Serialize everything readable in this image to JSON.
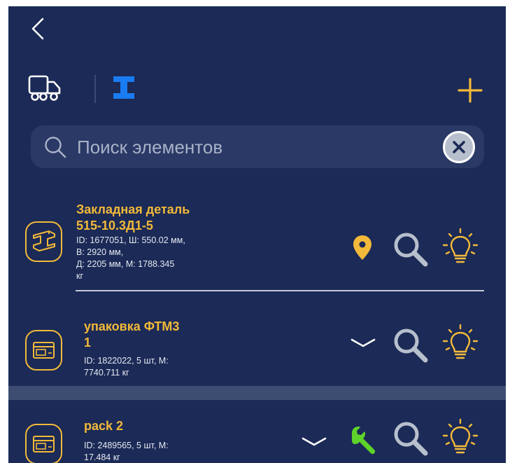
{
  "header": {
    "back_icon": "chevron-left-icon",
    "tabs": [
      {
        "icon": "truck-icon",
        "active": false
      },
      {
        "icon": "i-beam-icon",
        "active": true
      }
    ],
    "add_icon": "plus-icon"
  },
  "search": {
    "placeholder": "Поиск элементов",
    "value": ""
  },
  "items": [
    {
      "icon": "i-beam-icon",
      "title": "Закладная деталь\n515-10.3Д1-5",
      "meta": [
        "ID: 1677051, Ш: 550.02 мм,",
        "В: 2920 мм,",
        "Д: 2205 мм, М: 1788.345",
        "кг"
      ],
      "actions": [
        "location-pin-icon",
        "search-icon",
        "lightbulb-icon"
      ]
    },
    {
      "icon": "box-icon",
      "title": "упаковка ФТМ3\n1",
      "meta": [
        "ID: 1822022, 5 шт, М:",
        "7740.711 кг"
      ],
      "actions": [
        "chevron-down-icon",
        "search-icon",
        "lightbulb-icon"
      ]
    },
    {
      "icon": "box-icon",
      "title": "pack 2",
      "meta": [
        "ID: 2489565, 5 шт, М:",
        "17.484 кг"
      ],
      "actions": [
        "chevron-down-icon",
        "wrench-icon",
        "search-icon",
        "lightbulb-icon"
      ]
    }
  ],
  "colors": {
    "background": "#1b2a56",
    "accent": "#f3b93a",
    "active_tab": "#1a7cf2",
    "wrench": "#5ed32a",
    "search_icon": "#b7bfcd"
  }
}
